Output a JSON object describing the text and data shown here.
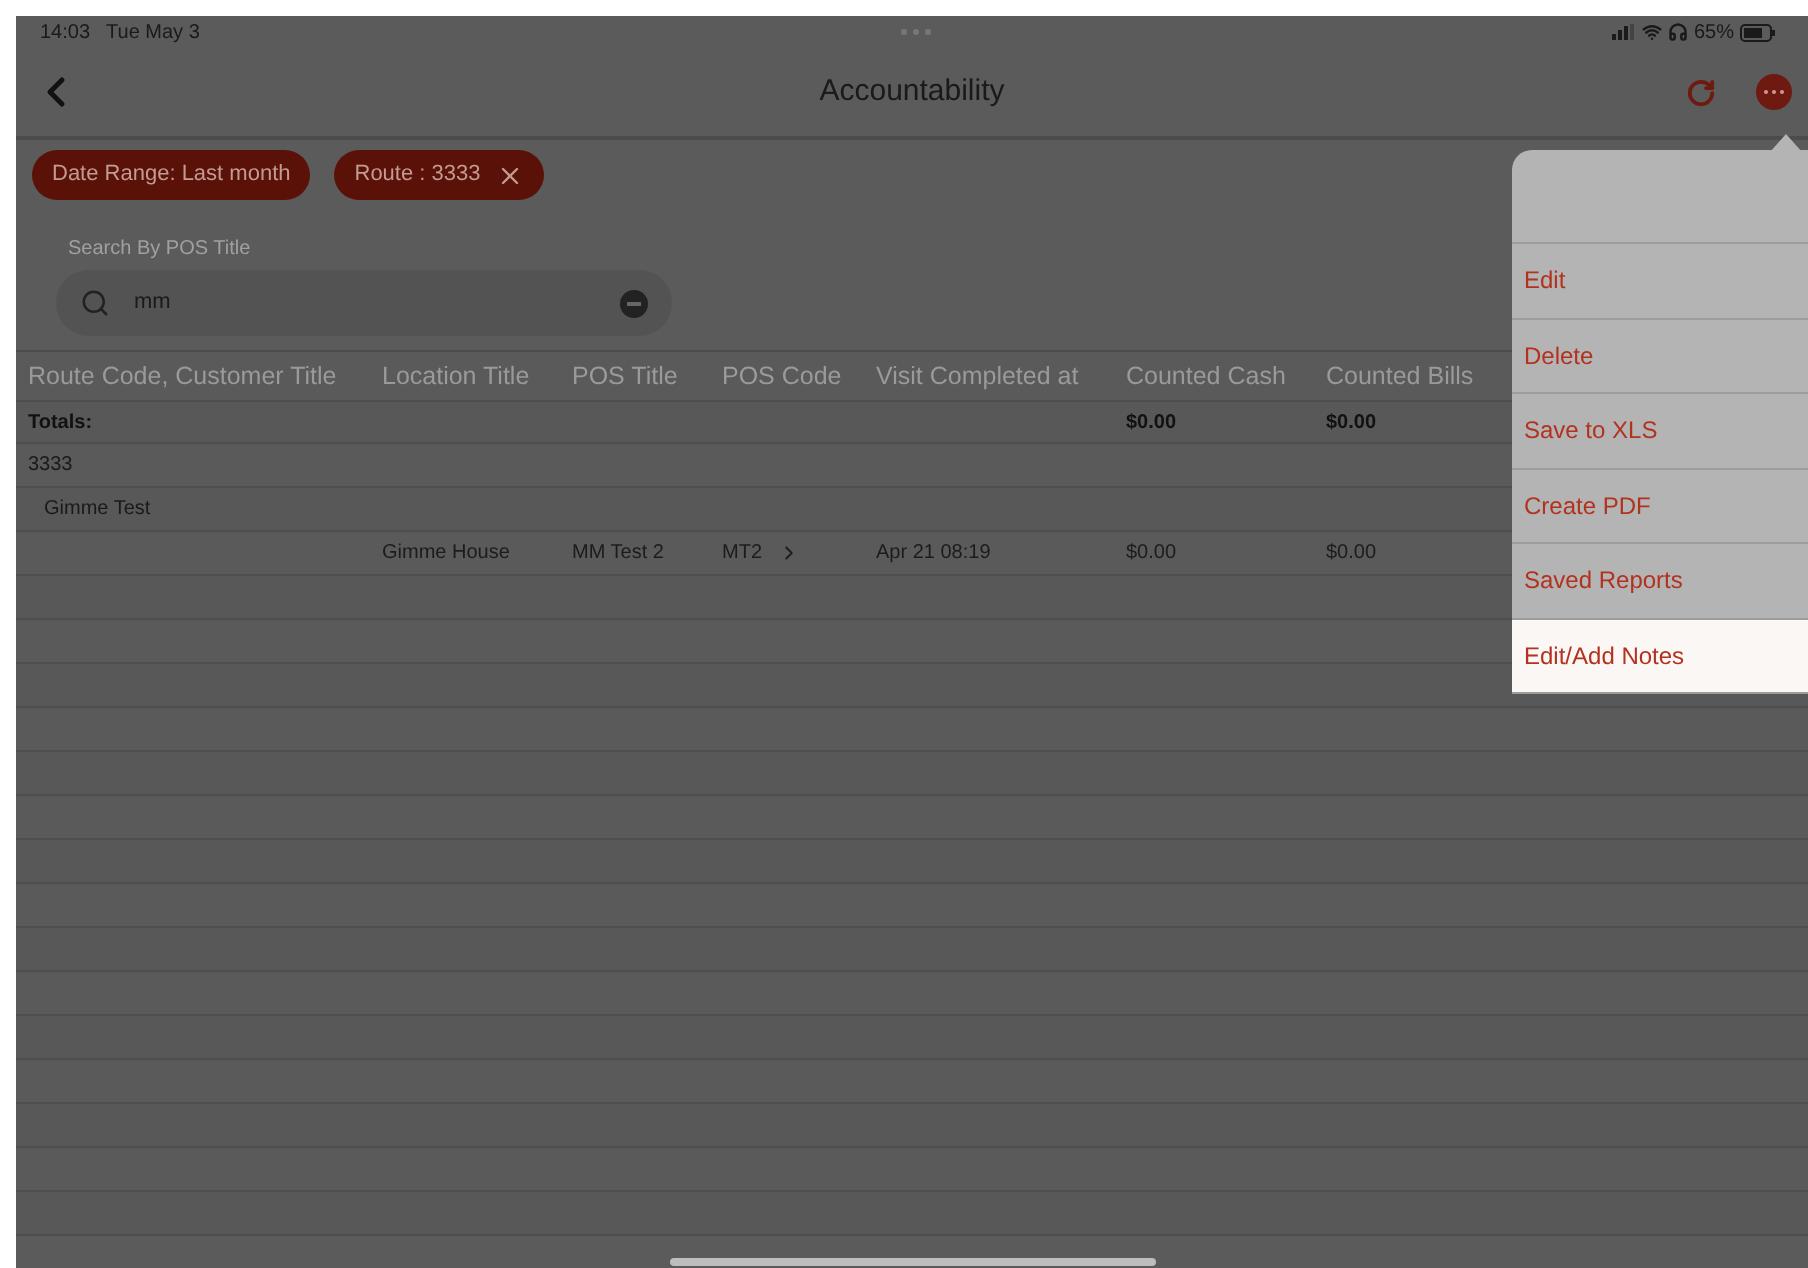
{
  "status_bar": {
    "time": "14:03",
    "date": "Tue May 3",
    "battery": "65%"
  },
  "nav": {
    "title": "Accountability"
  },
  "filters": [
    {
      "label": "Date Range: Last month",
      "removable": false
    },
    {
      "label": "Route : 3333",
      "removable": true
    }
  ],
  "search": {
    "label": "Search By POS Title",
    "value": "mm"
  },
  "table": {
    "columns": [
      "Route Code, Customer Title",
      "Location Title",
      "POS Title",
      "POS Code",
      "Visit Completed at",
      "Counted Cash",
      "Counted Bills"
    ],
    "totals": {
      "label": "Totals:",
      "counted_cash": "$0.00",
      "counted_bills": "$0.00"
    },
    "rows": [
      {
        "kind": "route",
        "label": "3333"
      },
      {
        "kind": "customer",
        "label": "Gimme Test"
      },
      {
        "kind": "visit",
        "cells": [
          "Gimme House",
          "MM Test 2",
          "MT2",
          "Apr 21 08:19",
          "$0.00",
          "$0.00"
        ]
      }
    ]
  },
  "menu": {
    "items": [
      {
        "label": "Edit",
        "selected": false
      },
      {
        "label": "Delete",
        "selected": false
      },
      {
        "label": "Save to XLS",
        "selected": false
      },
      {
        "label": "Create PDF",
        "selected": false
      },
      {
        "label": "Saved Reports",
        "selected": false
      },
      {
        "label": "Edit/Add Notes",
        "selected": true
      }
    ]
  }
}
